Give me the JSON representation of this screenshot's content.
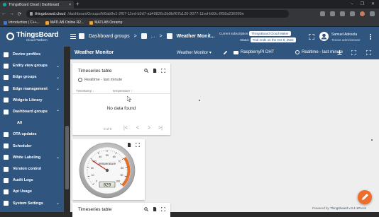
{
  "browser": {
    "tab_title": "ThingsBoard Cloud | Dashboard",
    "tab_close": "×",
    "new_tab": "+",
    "window_controls": [
      "–",
      "❐",
      "✕"
    ],
    "nav": [
      "←",
      "→",
      "⟳"
    ],
    "url_host": "thingsboard.cloud",
    "url_path": "/dashboardGroups/fd6ab9e1-2f07-11ed-b3d7-ab40826c6b9b/f67b120-3077-11ed-b60c-6f58a236995e",
    "bookmarks": [
      {
        "label": "Introduction | C++...",
        "color": "#3c78d8"
      },
      {
        "label": "MATLAB Online R2...",
        "color": "#e8a33d"
      },
      {
        "label": "MATLAB Onramp",
        "color": "#e8a33d"
      }
    ]
  },
  "header": {
    "logo_title": "ThingsBoard",
    "logo_subtitle": "Cloud Platform",
    "breadcrumb": [
      {
        "label": "Dashboard groups"
      },
      {
        "label": "..."
      },
      {
        "label": "Weather Monit..."
      }
    ],
    "breadcrumb_sep": ">",
    "subscription_label": "Current subscription",
    "subscription_value": "ThingsBoard Cloud Maker",
    "status_label": "Status",
    "status_value": "Trial ends on the Oct 8, 2022",
    "user_name": "Samuel Adesola",
    "user_role": "Tenant administrator"
  },
  "sidebar": {
    "items": [
      {
        "label": "Device profiles",
        "chevron": ""
      },
      {
        "label": "Entity view groups",
        "chevron": "⌄"
      },
      {
        "label": "Edge groups",
        "chevron": "⌄"
      },
      {
        "label": "Edge management",
        "chevron": "⌄"
      },
      {
        "label": "Widgets Library",
        "chevron": ""
      },
      {
        "label": "Dashboard groups",
        "chevron": "⌃"
      },
      {
        "label": "All",
        "chevron": "",
        "sub": true
      },
      {
        "label": "OTA updates",
        "chevron": ""
      },
      {
        "label": "Scheduler",
        "chevron": ""
      },
      {
        "label": "White Labeling",
        "chevron": "⌄"
      },
      {
        "label": "Version control",
        "chevron": ""
      },
      {
        "label": "Audit Logs",
        "chevron": ""
      },
      {
        "label": "Api Usage",
        "chevron": ""
      },
      {
        "label": "System Settings",
        "chevron": "⌄"
      }
    ]
  },
  "dashboard": {
    "title": "Weather Monitor",
    "state": "Weather Monitor ▾",
    "entity": "RaspberryPI DHT",
    "timewindow": "Realtime - last minute"
  },
  "widgets": {
    "timeseries": {
      "title": "Timeseries table",
      "timewindow": "Realtime - last minute",
      "columns": [
        "Timestamp ↓",
        "temperature ↑"
      ],
      "empty": "No data found",
      "pagination": "0 of 0",
      "pager": [
        "|<",
        "<",
        ">",
        ">|"
      ]
    },
    "gauge": {
      "label": "temperature",
      "value": "029",
      "ticks": [
        "0",
        "10",
        "20",
        "30",
        "40",
        "50",
        "60",
        "70",
        "80",
        "90",
        "100"
      ],
      "value_number": 29,
      "min": 0,
      "max": 100
    },
    "timeseries2_title": "Timeseries table"
  },
  "footer": {
    "powered": "Powered by",
    "brand": "Thingsboard v.3.4.1PAAS"
  },
  "colors": {
    "primary": "#305680",
    "accent": "#ef6c2a",
    "canvas": "#eeeeee"
  }
}
